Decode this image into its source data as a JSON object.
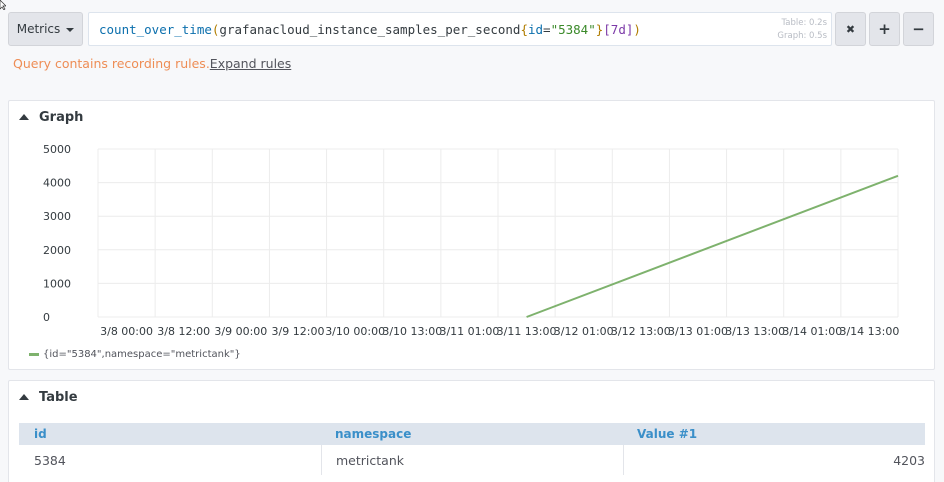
{
  "toolbar": {
    "metrics_label": "Metrics",
    "remove_label": "✖",
    "add_label": "+",
    "minus_label": "−"
  },
  "query": {
    "fn": "count_over_time",
    "open_paren": "(",
    "metric": "grafanacloud_instance_samples_per_second",
    "open_brace": "{",
    "label_key": "id",
    "eq": "=",
    "label_value": "\"5384\"",
    "close_brace": "}",
    "range": "[7d]",
    "close_paren": ")",
    "timing_table": "Table: 0.2s",
    "timing_graph": "Graph: 0.5s"
  },
  "warning": {
    "text": "Query contains recording rules.",
    "link": "Expand rules"
  },
  "graph": {
    "title": "Graph",
    "legend": "{id=\"5384\",namespace=\"metrictank\"}"
  },
  "chart_data": {
    "type": "line",
    "title": "",
    "xlabel": "",
    "ylabel": "",
    "x_ticks": [
      "3/8 00:00",
      "3/8 12:00",
      "3/9 00:00",
      "3/9 12:00",
      "3/10 00:00",
      "3/10 13:00",
      "3/11 01:00",
      "3/11 13:00",
      "3/12 01:00",
      "3/12 13:00",
      "3/13 01:00",
      "3/13 13:00",
      "3/14 01:00",
      "3/14 13:00"
    ],
    "y_ticks": [
      0,
      1000,
      2000,
      3000,
      4000,
      5000
    ],
    "ylim": [
      0,
      5000
    ],
    "grid": true,
    "legend_position": "bottom-left",
    "series": [
      {
        "name": "{id=\"5384\",namespace=\"metrictank\"}",
        "color": "#7eb26d",
        "points": [
          {
            "x": "3/11 13:00",
            "y": 0
          },
          {
            "x": "3/14 13:00",
            "y": 4203
          }
        ]
      }
    ]
  },
  "table": {
    "title": "Table",
    "headers": [
      "id",
      "namespace",
      "Value #1"
    ],
    "rows": [
      [
        "5384",
        "metrictank",
        "4203"
      ]
    ]
  }
}
